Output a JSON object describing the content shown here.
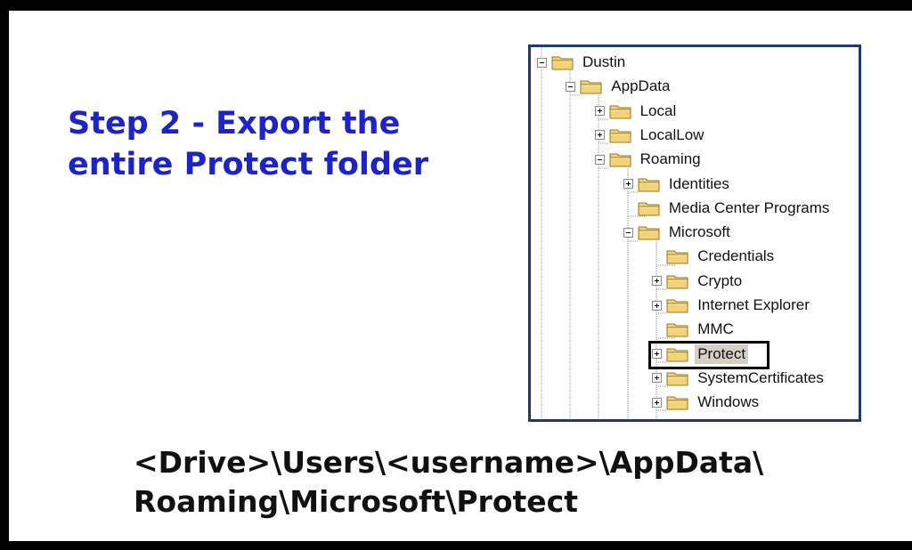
{
  "title": {
    "line1": "Step 2 - Export the",
    "line2": "entire Protect folder"
  },
  "path": {
    "line1": "<Drive>\\Users\\<username>\\AppData\\",
    "line2": "Roaming\\Microsoft\\Protect"
  },
  "colors": {
    "title": "#1c24c8",
    "tree_border": "#1f3b6e",
    "folder_fill": "#f3d27a",
    "selected_bg": "#d4d0c8"
  },
  "tree": {
    "nodes": [
      {
        "label": "Dustin",
        "expander": "minus",
        "icon": "folder-icon"
      },
      {
        "label": "AppData",
        "expander": "minus",
        "icon": "folder-icon"
      },
      {
        "label": "Local",
        "expander": "plus",
        "icon": "folder-icon"
      },
      {
        "label": "LocalLow",
        "expander": "plus",
        "icon": "folder-icon"
      },
      {
        "label": "Roaming",
        "expander": "minus",
        "icon": "folder-icon"
      },
      {
        "label": "Identities",
        "expander": "plus",
        "icon": "folder-icon"
      },
      {
        "label": "Media Center Programs",
        "expander": "none",
        "icon": "folder-icon"
      },
      {
        "label": "Microsoft",
        "expander": "minus",
        "icon": "folder-icon"
      },
      {
        "label": "Credentials",
        "expander": "none",
        "icon": "folder-icon"
      },
      {
        "label": "Crypto",
        "expander": "plus",
        "icon": "folder-icon"
      },
      {
        "label": "Internet Explorer",
        "expander": "plus",
        "icon": "folder-icon"
      },
      {
        "label": "MMC",
        "expander": "none",
        "icon": "folder-icon"
      },
      {
        "label": "Protect",
        "expander": "plus",
        "icon": "folder-icon",
        "selected": true
      },
      {
        "label": "SystemCertificates",
        "expander": "plus",
        "icon": "folder-icon"
      },
      {
        "label": "Windows",
        "expander": "plus",
        "icon": "folder-icon"
      }
    ]
  }
}
